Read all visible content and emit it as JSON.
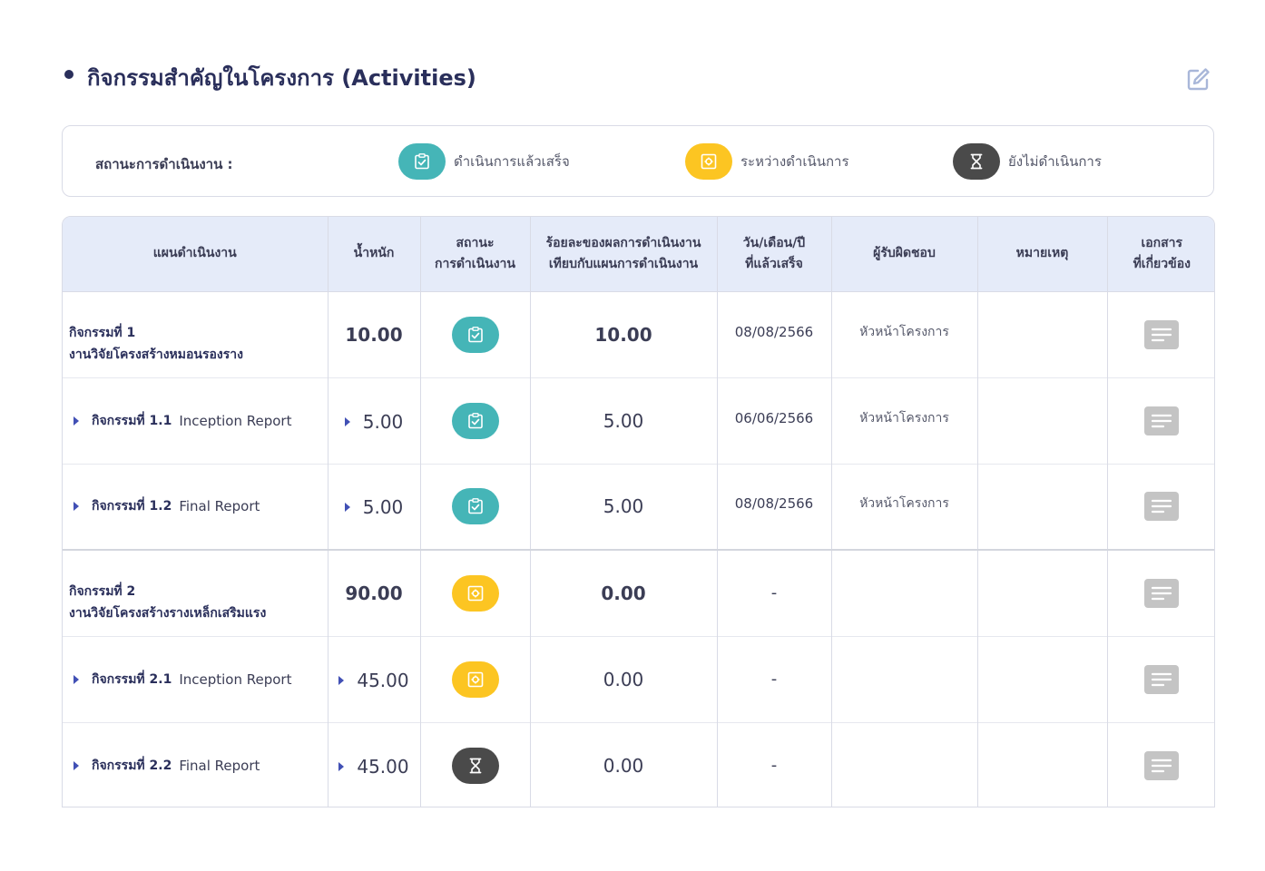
{
  "header": {
    "title": "กิจกรรมสำคัญในโครงการ (Activities)",
    "edit_icon": "edit-icon"
  },
  "legend": {
    "label": "สถานะการดำเนินงาน :",
    "items": [
      {
        "key": "done",
        "label": "ดำเนินการแล้วเสร็จ",
        "icon": "clipboard-check-icon",
        "color": "#45b5b7"
      },
      {
        "key": "progress",
        "label": "ระหว่างดำเนินการ",
        "icon": "gear-icon",
        "color": "#fcc522"
      },
      {
        "key": "pending",
        "label": "ยังไม่ดำเนินการ",
        "icon": "hourglass-icon",
        "color": "#4a4a4a"
      }
    ]
  },
  "table": {
    "columns": [
      "แผนดำเนินงาน",
      "น้ำหนัก",
      "สถานะ การดำเนินงาน",
      "ร้อยละของผลการดำเนินงาน เทียบกับแผนการดำเนินงาน",
      "วัน/เดือน/ปี ที่แล้วเสร็จ",
      "ผู้รับผิดชอบ",
      "หมายเหตุ",
      "เอกสาร ที่เกี่ยวข้อง"
    ],
    "col_lines": [
      [
        "แผนดำเนินงาน"
      ],
      [
        "น้ำหนัก"
      ],
      [
        "สถานะ",
        "การดำเนินงาน"
      ],
      [
        "ร้อยละของผลการดำเนินงาน",
        "เทียบกับแผนการดำเนินงาน"
      ],
      [
        "วัน/เดือน/ปี",
        "ที่แล้วเสร็จ"
      ],
      [
        "ผู้รับผิดชอบ"
      ],
      [
        "หมายเหตุ"
      ],
      [
        "เอกสาร",
        "ที่เกี่ยวข้อง"
      ]
    ],
    "rows": [
      {
        "level": "main",
        "code": "กิจกรรมที่ 1",
        "name": "งานวิจัยโครงสร้างหมอนรองราง",
        "weight": "10.00",
        "status": "done",
        "percent": "10.00",
        "date": "08/08/2566",
        "responsible": "หัวหน้าโครงการ",
        "note": ""
      },
      {
        "level": "sub",
        "code": "กิจกรรมที่ 1.1",
        "name": "Inception Report",
        "weight": "5.00",
        "status": "done",
        "percent": "5.00",
        "date": "06/06/2566",
        "responsible": "หัวหน้าโครงการ",
        "note": ""
      },
      {
        "level": "sub",
        "code": "กิจกรรมที่ 1.2",
        "name": "Final Report",
        "weight": "5.00",
        "status": "done",
        "percent": "5.00",
        "date": "08/08/2566",
        "responsible": "หัวหน้าโครงการ",
        "note": ""
      },
      {
        "level": "main",
        "code": "กิจกรรมที่ 2",
        "name": "งานวิจัยโครงสร้างรางเหล็กเสริมแรง",
        "weight": "90.00",
        "status": "progress",
        "percent": "0.00",
        "date": "-",
        "responsible": "",
        "note": ""
      },
      {
        "level": "sub",
        "code": "กิจกรรมที่ 2.1",
        "name": "Inception Report",
        "weight": "45.00",
        "status": "progress",
        "percent": "0.00",
        "date": "-",
        "responsible": "",
        "note": ""
      },
      {
        "level": "sub",
        "code": "กิจกรรมที่ 2.2",
        "name": "Final Report",
        "weight": "45.00",
        "status": "pending",
        "percent": "0.00",
        "date": "-",
        "responsible": "",
        "note": ""
      }
    ]
  }
}
